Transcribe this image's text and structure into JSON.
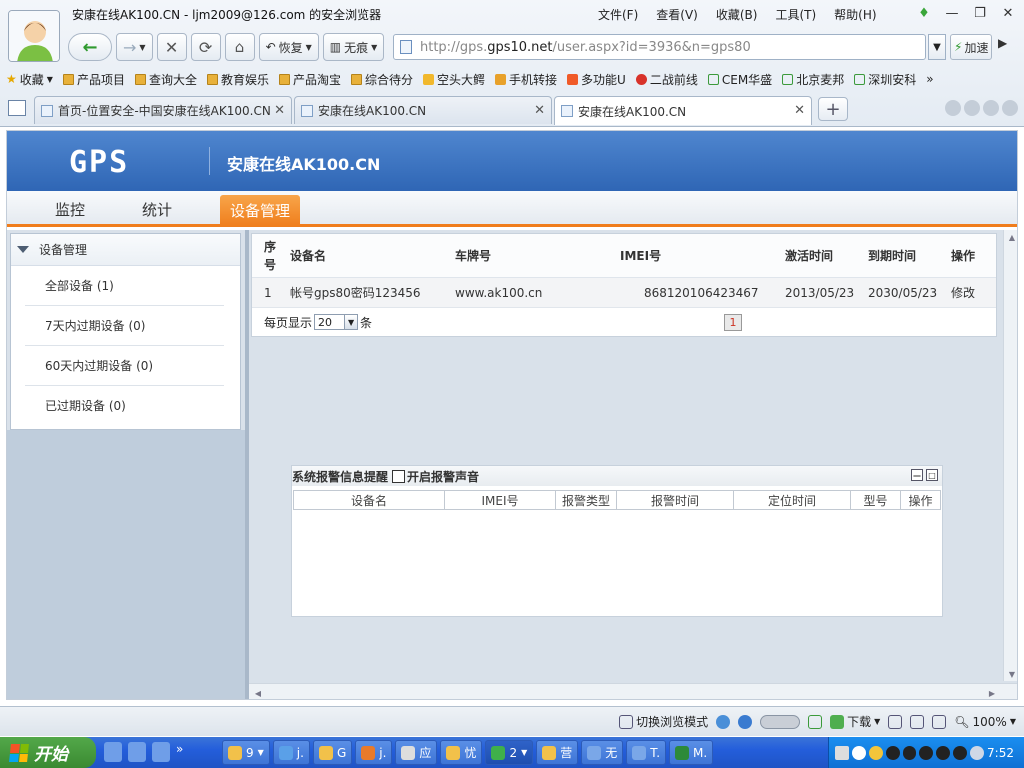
{
  "browser": {
    "window_title": "安康在线AK100.CN - ljm2009@126.com 的安全浏览器",
    "menu": [
      "文件(F)",
      "查看(V)",
      "收藏(B)",
      "工具(T)",
      "帮助(H)"
    ],
    "nav": {
      "restore_label": "恢复",
      "no_trace_label": "无痕",
      "accelerate_label": "加速"
    },
    "address": {
      "prefix": "http://gps.",
      "domain": "gps10.net",
      "suffix": "/user.aspx?id=3936&n=gps80"
    },
    "favorites_label": "收藏",
    "bookmarks": [
      "产品项目",
      "查询大全",
      "教育娱乐",
      "产品淘宝",
      "综合待分",
      "空头大鳄",
      "手机转接",
      "多功能U",
      "二战前线",
      "CEM华盛",
      "北京麦邦",
      "深圳安科"
    ],
    "more_bookmarks": "»",
    "tabs": [
      {
        "label": "首页-位置安全-中国安康在线AK100.CN",
        "active": false
      },
      {
        "label": "安康在线AK100.CN",
        "active": false
      },
      {
        "label": "安康在线AK100.CN",
        "active": true
      }
    ],
    "status": {
      "switch_mode": "切换浏览模式",
      "download": "下载",
      "zoom": "100%"
    }
  },
  "site": {
    "logo": "GPS",
    "title": "安康在线AK100.CN",
    "nav": [
      {
        "label": "监控",
        "active": false
      },
      {
        "label": "统计",
        "active": false
      },
      {
        "label": "设备管理",
        "active": true
      }
    ]
  },
  "sidebar": {
    "heading": "设备管理",
    "items": [
      {
        "label": "全部设备 (1)"
      },
      {
        "label": "7天内过期设备 (0)"
      },
      {
        "label": "60天内过期设备 (0)"
      },
      {
        "label": "已过期设备 (0)"
      }
    ]
  },
  "device_table": {
    "headers": {
      "index": "序号",
      "name": "设备名",
      "plate": "车牌号",
      "imei": "IMEI号",
      "activated": "激活时间",
      "expires": "到期时间",
      "action": "操作"
    },
    "rows": [
      {
        "index": "1",
        "name": "帐号gps80密码123456",
        "plate": "www.ak100.cn",
        "imei": "868120106423467",
        "activated": "2013/05/23",
        "expires": "2030/05/23",
        "action": "修改"
      }
    ],
    "pager": {
      "prefix": "每页显示",
      "page_size": "20",
      "suffix": "条",
      "current_page": "1"
    }
  },
  "alarm_panel": {
    "title": "系统报警信息提醒",
    "sound_label": "开启报警声音",
    "columns": [
      "设备名",
      "IMEI号",
      "报警类型",
      "报警时间",
      "定位时间",
      "型号",
      "操作"
    ]
  },
  "taskbar": {
    "start_label": "开始",
    "buttons": [
      "9",
      "j.",
      "G",
      "j.",
      "应",
      "忧",
      "2",
      "营",
      "无",
      "T.",
      "M."
    ],
    "clock": "7:52"
  }
}
